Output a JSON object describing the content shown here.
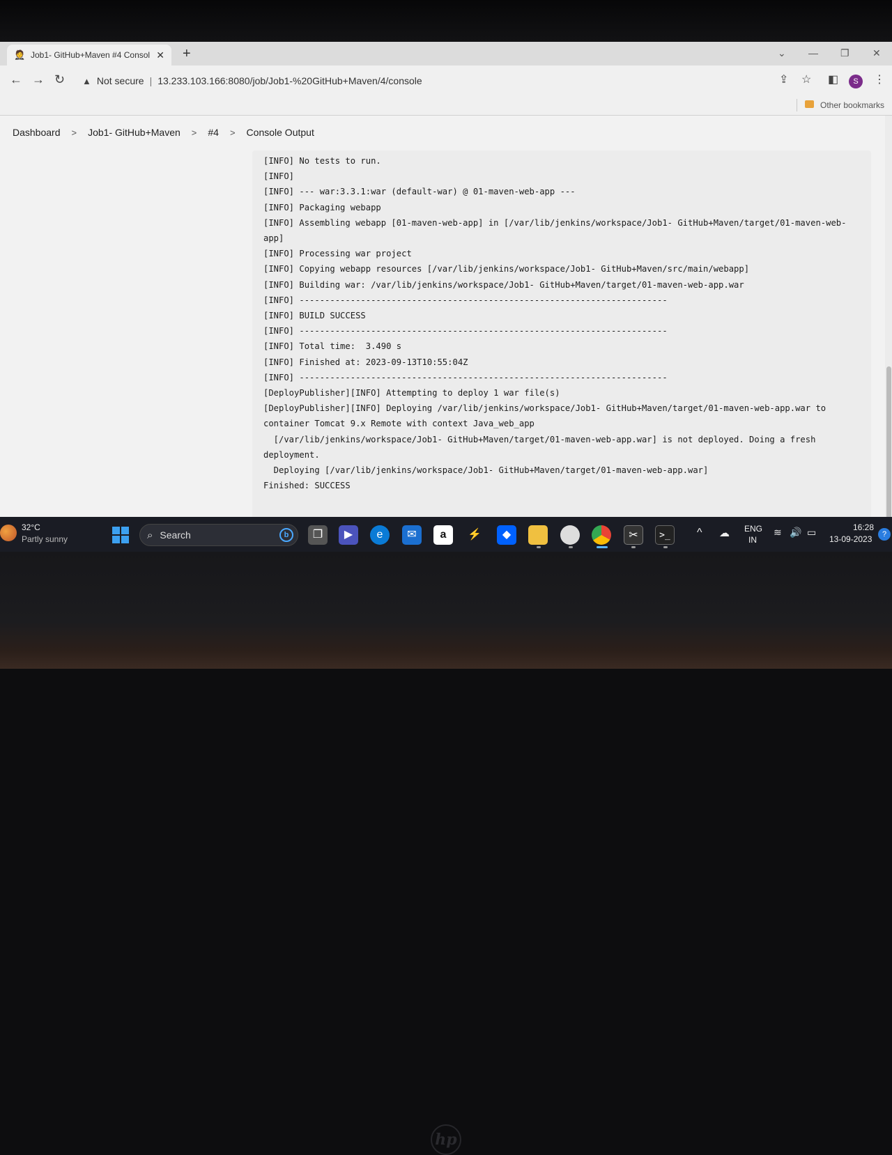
{
  "browser": {
    "tab_title": "Job1- GitHub+Maven #4 Consol",
    "tab_close": "✕",
    "new_tab": "+",
    "security_label": "Not secure",
    "url": "13.233.103.166:8080/job/Job1-%20GitHub+Maven/4/console",
    "bookmarks_label": "Other bookmarks",
    "profile_initial": "S"
  },
  "breadcrumb": {
    "items": [
      "Dashboard",
      "Job1- GitHub+Maven",
      "#4",
      "Console Output"
    ]
  },
  "console": {
    "lines": [
      "[INFO] No tests to run.",
      "[INFO]",
      "[INFO] --- war:3.3.1:war (default-war) @ 01-maven-web-app ---",
      "[INFO] Packaging webapp",
      "[INFO] Assembling webapp [01-maven-web-app] in [/var/lib/jenkins/workspace/Job1- GitHub+Maven/target/01-maven-web-",
      "app]",
      "[INFO] Processing war project",
      "[INFO] Copying webapp resources [/var/lib/jenkins/workspace/Job1- GitHub+Maven/src/main/webapp]",
      "[INFO] Building war: /var/lib/jenkins/workspace/Job1- GitHub+Maven/target/01-maven-web-app.war",
      "[INFO] ------------------------------------------------------------------------",
      "[INFO] BUILD SUCCESS",
      "[INFO] ------------------------------------------------------------------------",
      "[INFO] Total time:  3.490 s",
      "[INFO] Finished at: 2023-09-13T10:55:04Z",
      "[INFO] ------------------------------------------------------------------------",
      "[DeployPublisher][INFO] Attempting to deploy 1 war file(s)",
      "[DeployPublisher][INFO] Deploying /var/lib/jenkins/workspace/Job1- GitHub+Maven/target/01-maven-web-app.war to",
      "container Tomcat 9.x Remote with context Java_web_app",
      "  [/var/lib/jenkins/workspace/Job1- GitHub+Maven/target/01-maven-web-app.war] is not deployed. Doing a fresh",
      "deployment.",
      "  Deploying [/var/lib/jenkins/workspace/Job1- GitHub+Maven/target/01-maven-web-app.war]",
      "Finished: SUCCESS"
    ]
  },
  "taskbar": {
    "weather_temp": "32°C",
    "weather_desc": "Partly sunny",
    "search_label": "Search",
    "bing_label": "b",
    "lang_top": "ENG",
    "lang_bottom": "IN",
    "time": "16:28",
    "date": "13-09-2023",
    "amazon_label": "a"
  }
}
